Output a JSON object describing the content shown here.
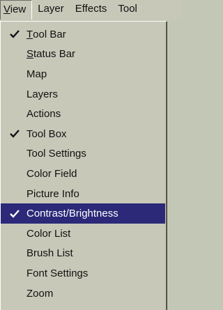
{
  "menubar": {
    "items": [
      {
        "label": "View",
        "mnemonic": "V",
        "rest": "iew",
        "open": true
      },
      {
        "label": "Layer"
      },
      {
        "label": "Effects"
      },
      {
        "label": "Tool"
      }
    ]
  },
  "dropdown": {
    "items": [
      {
        "label": "Tool Bar",
        "mnemonic": "T",
        "rest": "ool Bar",
        "checked": true,
        "selected": false
      },
      {
        "label": "Status Bar",
        "mnemonic": "S",
        "rest": "tatus Bar",
        "checked": false,
        "selected": false
      },
      {
        "label": "Map",
        "checked": false,
        "selected": false
      },
      {
        "label": "Layers",
        "checked": false,
        "selected": false
      },
      {
        "label": "Actions",
        "checked": false,
        "selected": false
      },
      {
        "label": "Tool Box",
        "checked": true,
        "selected": false
      },
      {
        "label": "Tool Settings",
        "checked": false,
        "selected": false
      },
      {
        "label": "Color Field",
        "checked": false,
        "selected": false
      },
      {
        "label": "Picture Info",
        "checked": false,
        "selected": false
      },
      {
        "label": "Contrast/Brightness",
        "checked": true,
        "selected": true
      },
      {
        "label": "Color List",
        "checked": false,
        "selected": false
      },
      {
        "label": "Brush List",
        "checked": false,
        "selected": false
      },
      {
        "label": "Font Settings",
        "checked": false,
        "selected": false
      },
      {
        "label": "Zoom",
        "checked": false,
        "selected": false
      }
    ]
  },
  "colors": {
    "menu_background": "#c8c8b9",
    "highlight": "#2b2978",
    "highlight_text": "#ffffff",
    "text": "#111111"
  },
  "icons": {
    "check": "check-icon"
  }
}
